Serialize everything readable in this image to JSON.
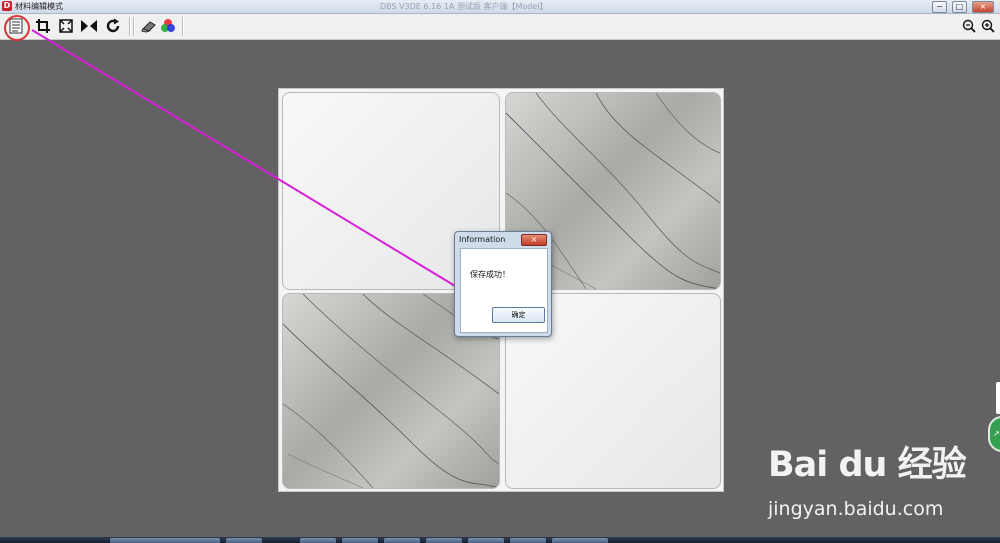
{
  "window": {
    "title": "材料编辑模式",
    "center_title": "DBS V3DE 6.16 1A 测试版 客户端【Model】",
    "app_icon": "D",
    "controls": {
      "minimize": "−",
      "maximize": "□",
      "close": "×"
    }
  },
  "toolbar": {
    "tools": [
      "save-material-icon",
      "crop-icon",
      "fit-frame-icon",
      "mirror-flip-icon",
      "rotate-icon",
      "eraser-icon",
      "color-rgb-icon"
    ],
    "zoom": [
      "zoom-out-icon",
      "zoom-in-icon"
    ]
  },
  "canvas": {
    "tiles": [
      {
        "name": "tile-top-left",
        "style": "white"
      },
      {
        "name": "tile-top-right",
        "style": "marble"
      },
      {
        "name": "tile-bottom-left",
        "style": "marble"
      },
      {
        "name": "tile-bottom-right",
        "style": "white"
      }
    ]
  },
  "dialog": {
    "title": "Information",
    "close_label": "×",
    "message": "保存成功！",
    "ok_label": "确定"
  },
  "annotation": {
    "color": "#d61fd6"
  },
  "side": {
    "button_label": "↗"
  },
  "watermark": {
    "logo": "Bai du 经验",
    "url": "jingyan.baidu.com"
  }
}
